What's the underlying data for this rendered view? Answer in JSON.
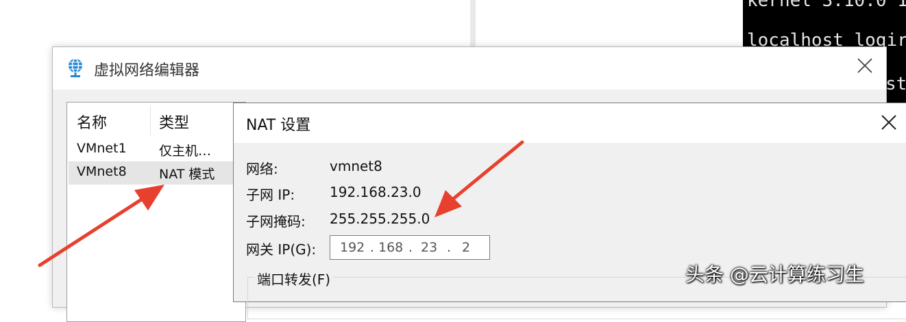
{
  "terminal": {
    "lines": [
      "kernel 3.10.0 1",
      "localhost logir",
      "st"
    ]
  },
  "editor": {
    "title": "虚拟网络编辑器",
    "columns": {
      "name": "名称",
      "type": "类型"
    },
    "networks": [
      {
        "name": "VMnet1",
        "type": "仅主机…"
      },
      {
        "name": "VMnet8",
        "type": "NAT 模式"
      }
    ]
  },
  "nat": {
    "title": "NAT 设置",
    "network_label": "网络:",
    "network_value": "vmnet8",
    "subnet_ip_label": "子网 IP:",
    "subnet_ip_value": "192.168.23.0",
    "subnet_mask_label": "子网掩码:",
    "subnet_mask_value": "255.255.255.0",
    "gateway_label": "网关 IP(G):",
    "gateway_octets": [
      "192",
      "168",
      "23",
      "2"
    ],
    "port_forwarding_label": "端口转发(F)"
  },
  "watermark": "头条 @云计算练习生",
  "colors": {
    "arrow": "#e8402f",
    "selected_row": "#e5e5e5"
  }
}
